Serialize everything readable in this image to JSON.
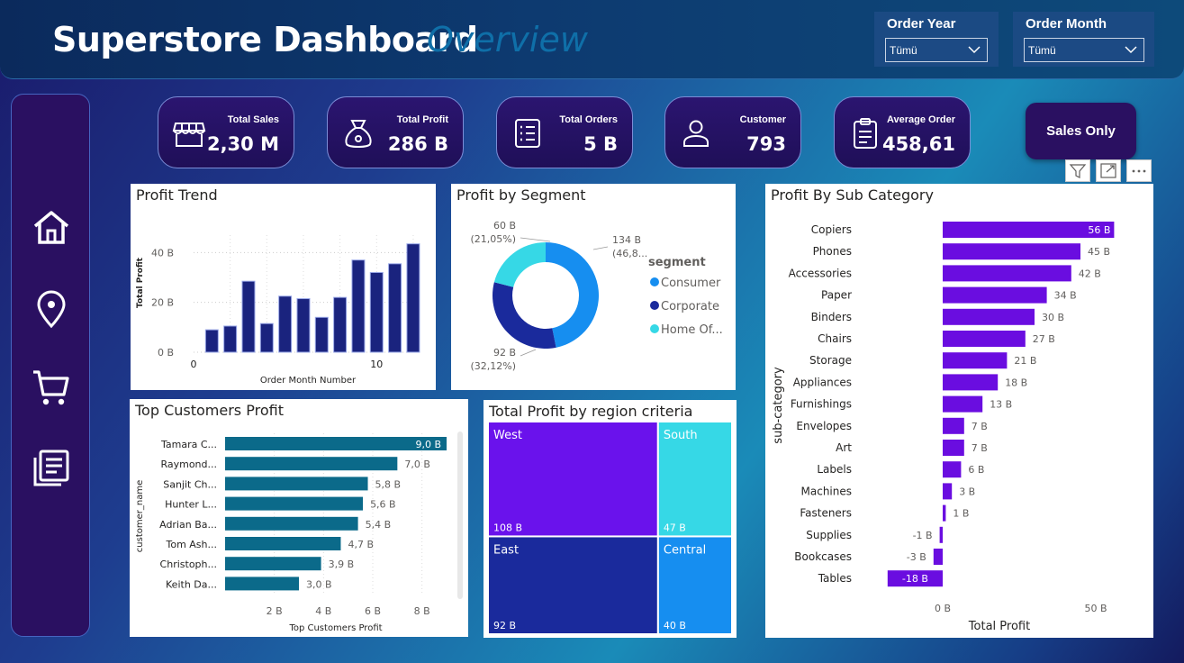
{
  "header": {
    "title": "Superstore Dashboard",
    "subtitle": "Overview"
  },
  "slicers": [
    {
      "label": "Order Year",
      "value": "Tümü"
    },
    {
      "label": "Order Month",
      "value": "Tümü"
    }
  ],
  "nav": {
    "items": [
      "home-icon",
      "location-pin-icon",
      "cart-icon",
      "document-list-icon"
    ]
  },
  "kpis": [
    {
      "label": "Total Sales",
      "value": "2,30 M",
      "icon": "store-icon"
    },
    {
      "label": "Total Profit",
      "value": "286 B",
      "icon": "money-bag-icon"
    },
    {
      "label": "Total Orders",
      "value": "5 B",
      "icon": "list-icon"
    },
    {
      "label": "Customer",
      "value": "793",
      "icon": "person-icon"
    },
    {
      "label": "Average Order",
      "value": "458,61",
      "icon": "clipboard-icon"
    }
  ],
  "sales_only_label": "Sales Only",
  "visual_header": [
    "filter-icon",
    "focus-mode-icon",
    "more-options-icon"
  ],
  "colors": {
    "bar_dark": "#1a237e",
    "customer_bar": "#0b6a8a",
    "subcat_bar": "#6a0de0",
    "consumer": "#168ef0",
    "corporate": "#1a2a9c",
    "home_office": "#36d8e6",
    "west": "#6a12ec",
    "south": "#36d8e6",
    "east": "#1a2a9c",
    "central": "#168ef0"
  },
  "chart_data": [
    {
      "id": "profit-trend",
      "type": "bar",
      "title": "Profit Trend",
      "xlabel": "Order Month Number",
      "ylabel": "Total Profit",
      "x": [
        1,
        2,
        3,
        4,
        5,
        6,
        7,
        8,
        9,
        10,
        11,
        12
      ],
      "values": [
        9,
        10.5,
        28.5,
        11.5,
        22.5,
        21.5,
        14,
        22,
        37,
        32,
        35.5,
        43.5
      ],
      "xticks": [
        "0",
        "10"
      ],
      "yticks": [
        "0 B",
        "20 B",
        "40 B"
      ],
      "ylim": [
        0,
        47
      ],
      "grid": true
    },
    {
      "id": "profit-by-segment",
      "type": "pie",
      "title": "Profit by Segment",
      "legend_title": "segment",
      "legend_position": "right",
      "slices": [
        {
          "name": "Consumer",
          "legend": "Consumer",
          "value": 134,
          "label": "134 B",
          "pct": "(46,8...",
          "color": "#168ef0"
        },
        {
          "name": "Corporate",
          "legend": "Corporate",
          "value": 92,
          "label": "92 B",
          "pct": "(32,12%)",
          "color": "#1a2a9c"
        },
        {
          "name": "Home Office",
          "legend": "Home Of...",
          "value": 60,
          "label": "60 B",
          "pct": "(21,05%)",
          "color": "#36d8e6"
        }
      ]
    },
    {
      "id": "profit-by-sub-category",
      "type": "bar",
      "orientation": "horizontal",
      "title": "Profit By Sub Category",
      "xlabel": "Total Profit",
      "ylabel": "sub-category",
      "categories": [
        "Copiers",
        "Phones",
        "Accessories",
        "Paper",
        "Binders",
        "Chairs",
        "Storage",
        "Appliances",
        "Furnishings",
        "Envelopes",
        "Art",
        "Labels",
        "Machines",
        "Fasteners",
        "Supplies",
        "Bookcases",
        "Tables"
      ],
      "values": [
        56,
        45,
        42,
        34,
        30,
        27,
        21,
        18,
        13,
        7,
        7,
        6,
        3,
        1,
        -1,
        -3,
        -18
      ],
      "labels": [
        "56 B",
        "45 B",
        "42 B",
        "34 B",
        "30 B",
        "27 B",
        "21 B",
        "18 B",
        "13 B",
        "7 B",
        "7 B",
        "6 B",
        "3 B",
        "1 B",
        "-1 B",
        "-3 B",
        "-18 B"
      ],
      "xticks": [
        "0 B",
        "50 B"
      ],
      "xlim": [
        -18,
        56
      ]
    },
    {
      "id": "top-customers-profit",
      "type": "bar",
      "orientation": "horizontal",
      "title": "Top Customers Profit",
      "xlabel": "Top Customers Profit",
      "ylabel": "customer_name",
      "categories": [
        "Tamara C...",
        "Raymond...",
        "Sanjit Ch...",
        "Hunter L...",
        "Adrian Ba...",
        "Tom Ash...",
        "Christoph...",
        "Keith Da..."
      ],
      "values": [
        9.0,
        7.0,
        5.8,
        5.6,
        5.4,
        4.7,
        3.9,
        3.0
      ],
      "labels": [
        "9,0 B",
        "7,0 B",
        "5,8 B",
        "5,6 B",
        "5,4 B",
        "4,7 B",
        "3,9 B",
        "3,0 B"
      ],
      "xticks": [
        "2 B",
        "4 B",
        "6 B",
        "8 B"
      ],
      "xlim": [
        0,
        9
      ]
    },
    {
      "id": "total-profit-by-region",
      "type": "treemap",
      "title": "Total Profit by region criteria",
      "items": [
        {
          "name": "West",
          "value": 108,
          "label": "108 B",
          "color": "#6a12ec"
        },
        {
          "name": "South",
          "value": 47,
          "label": "47 B",
          "color": "#36d8e6"
        },
        {
          "name": "East",
          "value": 92,
          "label": "92 B",
          "color": "#1a2a9c"
        },
        {
          "name": "Central",
          "value": 40,
          "label": "40 B",
          "color": "#168ef0"
        }
      ]
    }
  ]
}
